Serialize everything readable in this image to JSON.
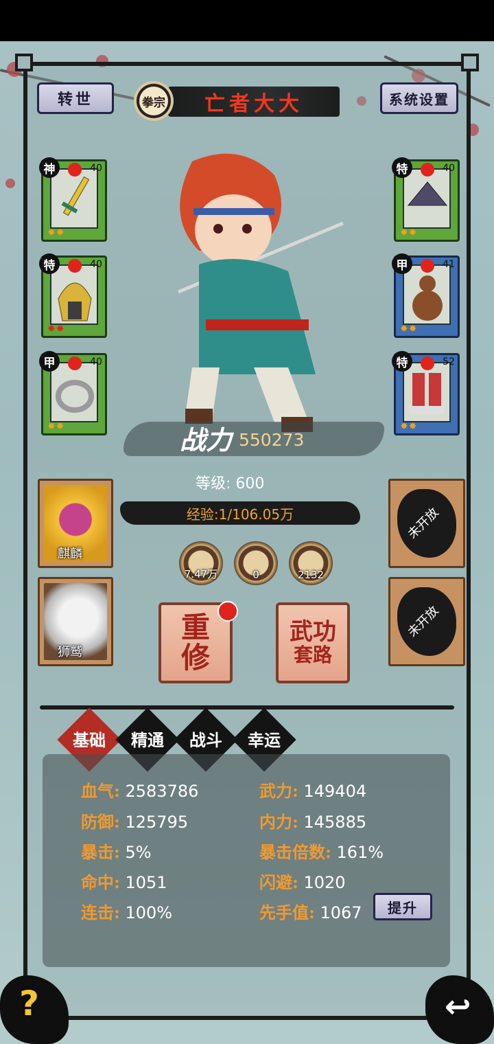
{
  "header": {
    "rebirth_label": "转世",
    "settings_label": "系统设置",
    "sect_label": "拳宗",
    "player_name": "亡者大大"
  },
  "equipment": {
    "left": [
      {
        "tag": "神",
        "level": "40",
        "stars": "✸✸",
        "frame": "green",
        "icon": "sword-icon"
      },
      {
        "tag": "特",
        "level": "40",
        "stars": "✸✸",
        "frame": "green",
        "icon": "helmet-icon"
      },
      {
        "tag": "甲",
        "level": "40",
        "stars": "✸✸",
        "frame": "green",
        "icon": "ring-icon"
      }
    ],
    "right": [
      {
        "tag": "特",
        "level": "40",
        "stars": "✸✸",
        "frame": "green",
        "icon": "hat-icon"
      },
      {
        "tag": "甲",
        "level": "41",
        "stars": "✸✸",
        "frame": "blue",
        "icon": "gourd-icon"
      },
      {
        "tag": "特",
        "level": "52",
        "stars": "✸✸",
        "frame": "blue",
        "icon": "boots-icon"
      }
    ]
  },
  "combat": {
    "power_label": "战力",
    "power_value": "550273",
    "level_text": "等级: 600",
    "exp_text": "经验:1/106.05万"
  },
  "mounts": [
    {
      "name": "麒麟",
      "icon": "qilin-icon"
    },
    {
      "name": "狮鹫",
      "icon": "griffin-icon"
    }
  ],
  "locked_slots": [
    "未开放",
    "未开放"
  ],
  "resources": [
    "7.47万",
    "0",
    "2132"
  ],
  "actions": {
    "rebuild_line1": "重",
    "rebuild_line2": "修",
    "martial_line1": "武功",
    "martial_line2": "套路"
  },
  "tabs": [
    "基础",
    "精通",
    "战斗",
    "幸运"
  ],
  "stats": {
    "left": [
      {
        "k": "血气:",
        "v": "2583786"
      },
      {
        "k": "防御:",
        "v": "125795"
      },
      {
        "k": "暴击:",
        "v": "5%"
      },
      {
        "k": "命中:",
        "v": "1051"
      },
      {
        "k": "连击:",
        "v": "100%"
      }
    ],
    "right": [
      {
        "k": "武力:",
        "v": "149404"
      },
      {
        "k": "内力:",
        "v": "145885"
      },
      {
        "k": "暴击倍数:",
        "v": "161%"
      },
      {
        "k": "闪避:",
        "v": "1020"
      },
      {
        "k": "先手值:",
        "v": "1067"
      }
    ],
    "upgrade_label": "提升"
  },
  "footer": {
    "help_label": "?",
    "back_label": "↩"
  }
}
